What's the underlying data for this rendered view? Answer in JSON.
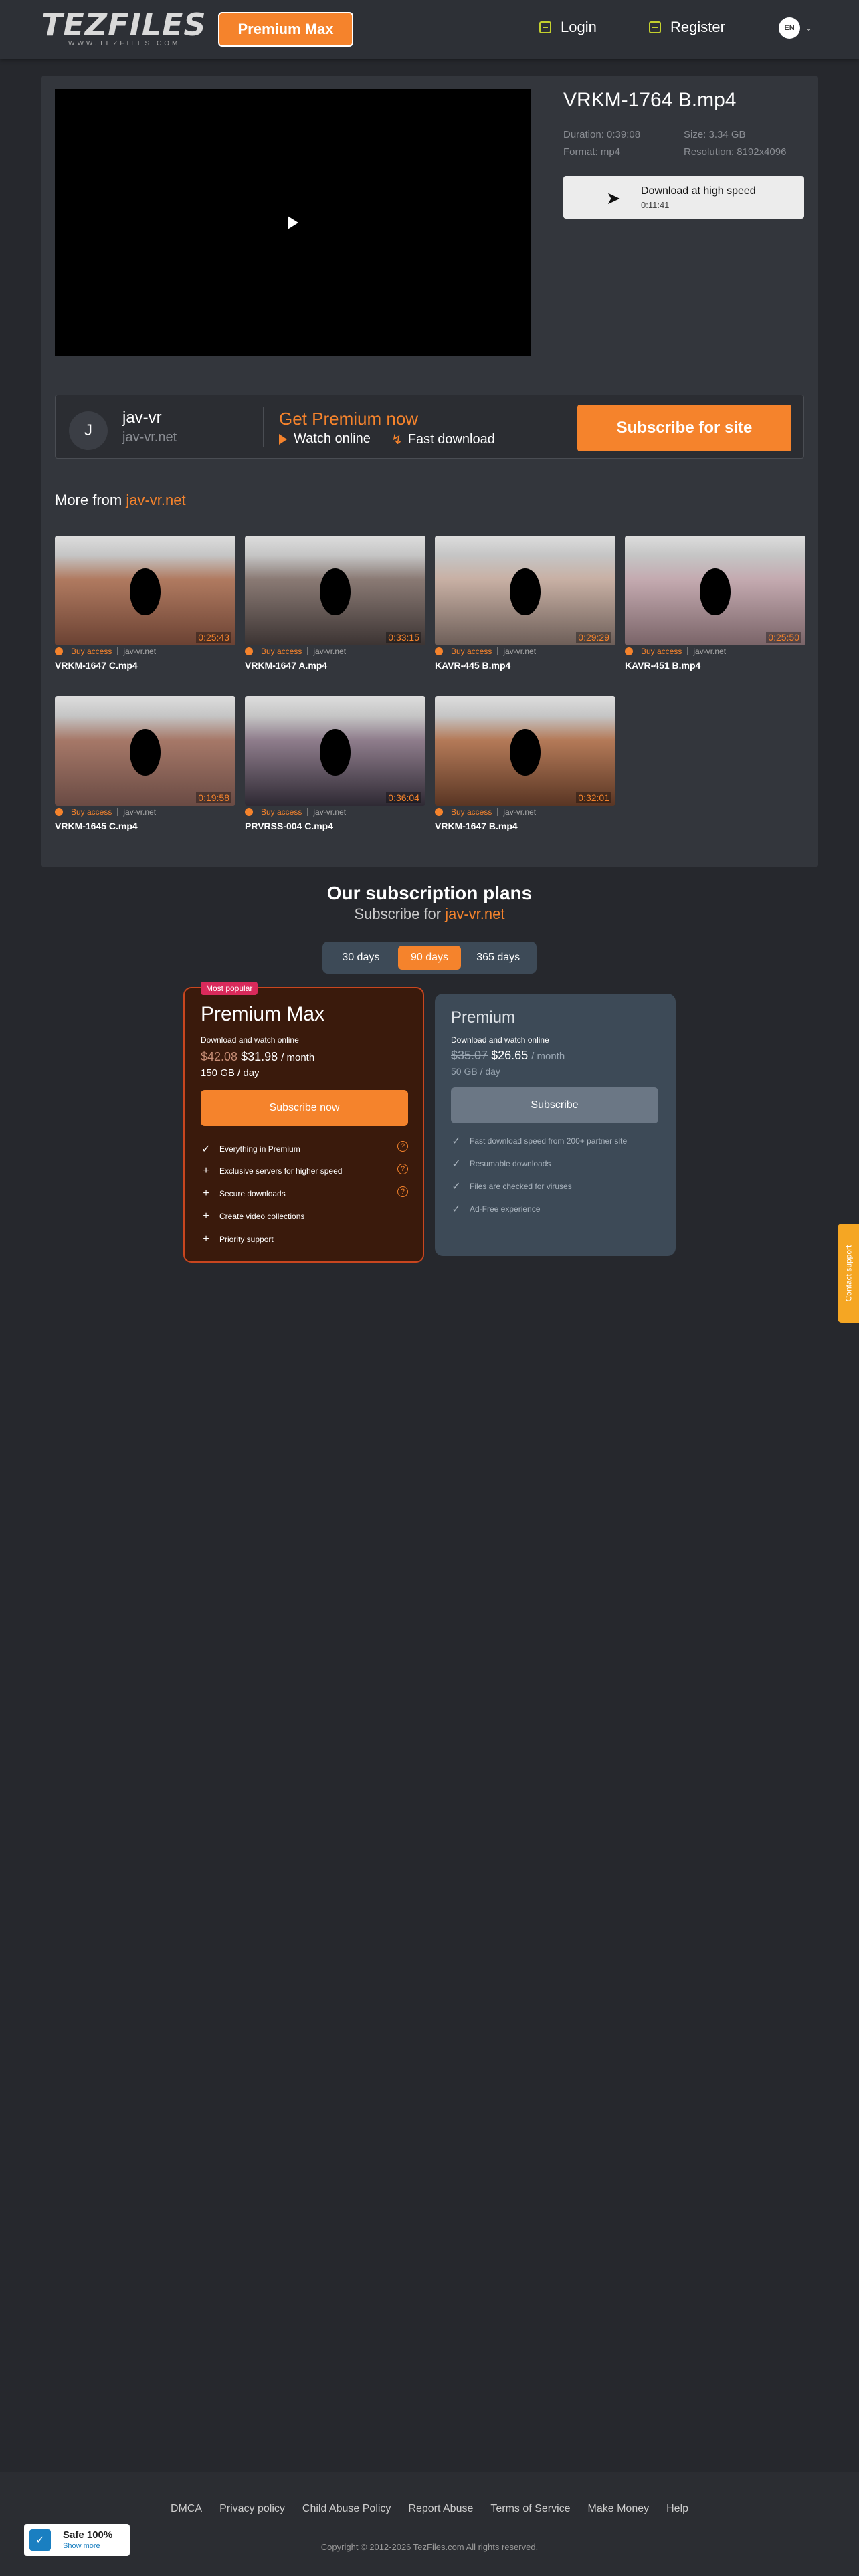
{
  "header": {
    "logo_text": "TEZFILES",
    "logo_sub": "WWW.TEZFILES.COM",
    "premium_max_label": "Premium Max",
    "login_label": "Login",
    "register_label": "Register",
    "lang": "EN"
  },
  "file": {
    "title": "VRKM-1764 B.mp4",
    "duration": "Duration: 0:39:08",
    "size": "Size: 3.34 GB",
    "format": "Format: mp4",
    "resolution": "Resolution: 8192x4096",
    "download_label": "Download at high speed",
    "download_time": "0:11:41"
  },
  "promo": {
    "avatar_letter": "J",
    "site_name": "jav-vr",
    "site_domain": "jav-vr.net",
    "get_premium": "Get Premium now",
    "watch_online": "Watch online",
    "fast_download": "Fast download",
    "subscribe_label": "Subscribe for site"
  },
  "more_from": {
    "prefix": "More from ",
    "site": "jav-vr.net"
  },
  "thumbs": [
    {
      "name": "VRKM-1647 C.mp4",
      "duration": "0:25:43",
      "buy": "Buy access",
      "domain": "jav-vr.net",
      "c1": "#b07a60",
      "c2": "#6b4233"
    },
    {
      "name": "VRKM-1647 A.mp4",
      "duration": "0:33:15",
      "buy": "Buy access",
      "domain": "jav-vr.net",
      "c1": "#8a7a74",
      "c2": "#3c3433"
    },
    {
      "name": "KAVR-445 B.mp4",
      "duration": "0:29:29",
      "buy": "Buy access",
      "domain": "jav-vr.net",
      "c1": "#c8b0a4",
      "c2": "#6d5e58"
    },
    {
      "name": "KAVR-451 B.mp4",
      "duration": "0:25:50",
      "buy": "Buy access",
      "domain": "jav-vr.net",
      "c1": "#c4aab0",
      "c2": "#7a6468"
    },
    {
      "name": "VRKM-1645 C.mp4",
      "duration": "0:19:58",
      "buy": "Buy access",
      "domain": "jav-vr.net",
      "c1": "#a67868",
      "c2": "#6a4b44"
    },
    {
      "name": "PRVRSS-004 C.mp4",
      "duration": "0:36:04",
      "buy": "Buy access",
      "domain": "jav-vr.net",
      "c1": "#8f7d8c",
      "c2": "#2f2a34"
    },
    {
      "name": "VRKM-1647 B.mp4",
      "duration": "0:32:01",
      "buy": "Buy access",
      "domain": "jav-vr.net",
      "c1": "#b47a58",
      "c2": "#5a3624"
    }
  ],
  "plans": {
    "title": "Our subscription plans",
    "subtitle_prefix": "Subscribe for ",
    "subtitle_site": "jav-vr.net",
    "periods": [
      "30 days",
      "90 days",
      "365 days"
    ],
    "active_period": "90 days",
    "max": {
      "badge": "Most popular",
      "name": "Premium Max",
      "desc": "Download and watch online",
      "old_price": "$42.08",
      "price": "$31.98",
      "per": "/ month",
      "quota": "150 GB / day",
      "button": "Subscribe now",
      "features": [
        "Everything in Premium",
        "Exclusive servers for higher speed",
        "Secure downloads",
        "Create video collections",
        "Priority support"
      ]
    },
    "premium": {
      "name": "Premium",
      "desc": "Download and watch online",
      "old_price": "$35.07",
      "price": "$26.65",
      "per": "/ month",
      "quota": "50 GB / day",
      "button": "Subscribe",
      "features": [
        "Fast download speed from 200+ partner site",
        "Resumable downloads",
        "Files are checked for viruses",
        "Ad-Free experience"
      ]
    }
  },
  "contact_tab": "Contact support",
  "footer": {
    "links": [
      "DMCA",
      "Privacy policy",
      "Child Abuse Policy",
      "Report Abuse",
      "Terms of Service",
      "Make Money",
      "Help"
    ],
    "copyright": "Copyright © 2012-2026 TezFiles.com All rights reserved."
  },
  "safe_badge": {
    "title": "Safe 100%",
    "link": "Show more"
  },
  "colors": {
    "accent": "#f5832c",
    "bg": "#26282d",
    "panel": "#33363c",
    "badge": "#d92a5b"
  }
}
